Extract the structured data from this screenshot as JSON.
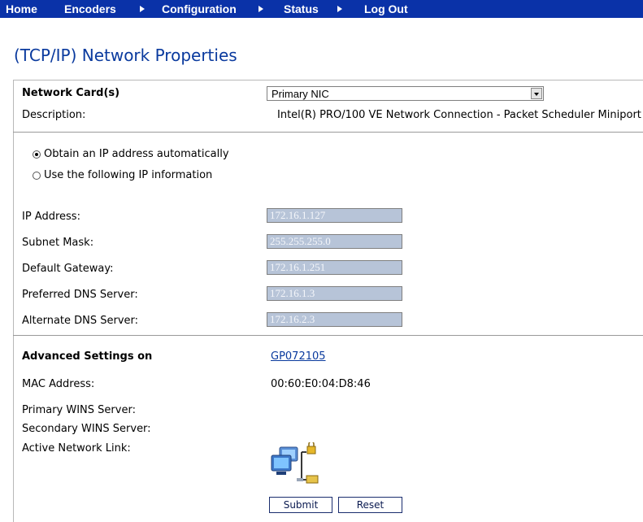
{
  "nav": {
    "items": [
      "Home",
      "Encoders",
      "Configuration",
      "Status",
      "Log Out"
    ]
  },
  "page": {
    "title": "(TCP/IP) Network Properties"
  },
  "network_card": {
    "label": "Network Card(s)",
    "selected": "Primary NIC",
    "description_label": "Description:",
    "description_value": "Intel(R) PRO/100 VE Network Connection - Packet Scheduler Miniport"
  },
  "ip_mode": {
    "auto_label": "Obtain an IP address automatically",
    "manual_label": "Use the following IP information",
    "selected": "auto"
  },
  "ip_fields": [
    {
      "label": "IP Address:",
      "value": "172.16.1.127"
    },
    {
      "label": "Subnet Mask:",
      "value": "255.255.255.0"
    },
    {
      "label": "Default Gateway:",
      "value": "172.16.1.251"
    },
    {
      "label": "Preferred DNS Server:",
      "value": "172.16.1.3"
    },
    {
      "label": "Alternate DNS Server:",
      "value": "172.16.2.3"
    }
  ],
  "advanced": {
    "label": "Advanced Settings on",
    "host_link": "GP072105",
    "mac_label": "MAC Address:",
    "mac_value": "00:60:E0:04:D8:46",
    "primary_wins_label": "Primary WINS Server:",
    "secondary_wins_label": "Secondary WINS Server:",
    "active_link_label": "Active Network Link:",
    "active_link_icon": "network-connection-icon"
  },
  "actions": {
    "submit": "Submit",
    "reset": "Reset"
  },
  "colors": {
    "nav_bg": "#0a32a8",
    "title": "#0a3a9e",
    "disabled_input_bg": "#b7c4d8"
  }
}
